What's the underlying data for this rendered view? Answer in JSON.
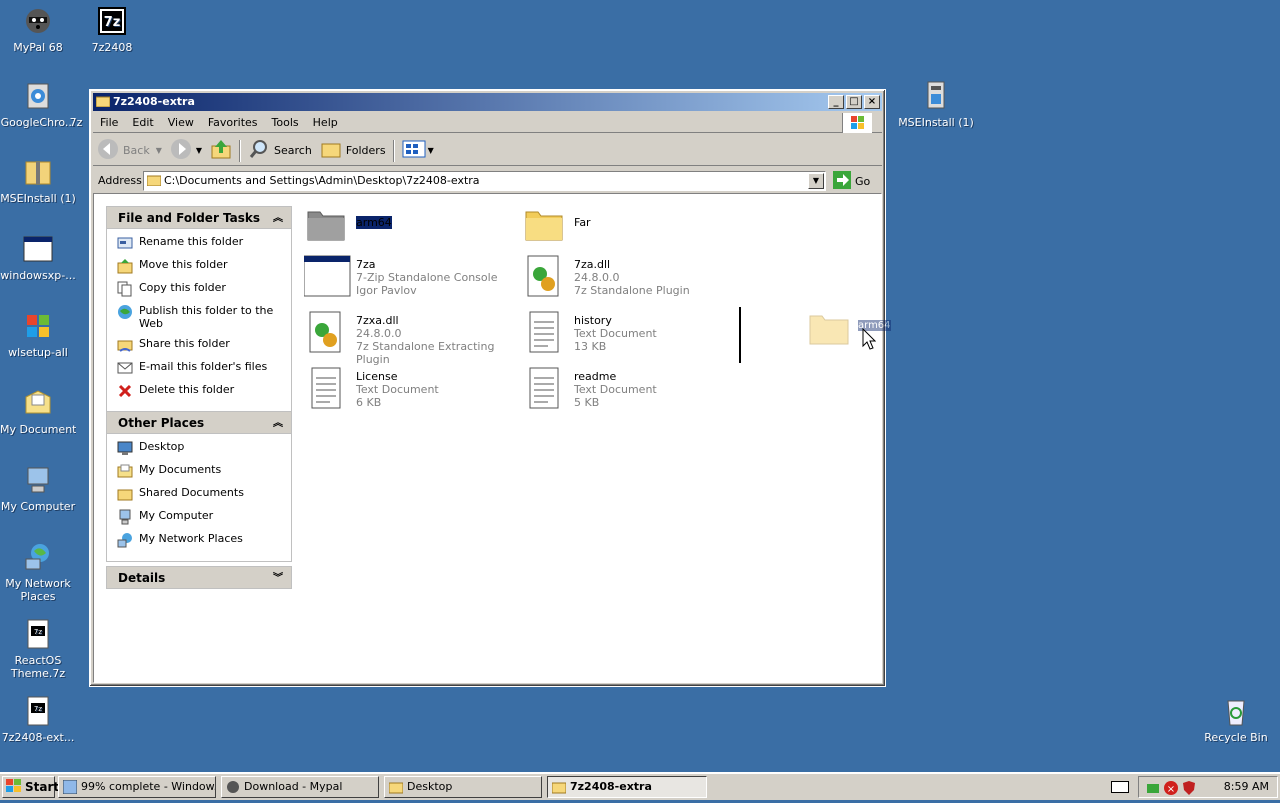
{
  "desktop": {
    "icons": [
      {
        "label": "MyPal 68"
      },
      {
        "label": "7z2408"
      },
      {
        "label": "GoogleChro..."
      },
      {
        "label": "7z"
      },
      {
        "label": "MSEInstall (1)"
      },
      {
        "label": "windowsxp-..."
      },
      {
        "label": "wlsetup-all"
      },
      {
        "label": "My Documents"
      },
      {
        "label": "My Computer"
      },
      {
        "label": "My Network Places"
      },
      {
        "label": "ReactOS Theme.7z"
      },
      {
        "label": "7z2408-ext..."
      },
      {
        "label": "MSEInstall (1)"
      },
      {
        "label": "Recycle Bin"
      }
    ]
  },
  "window": {
    "title": "7z2408-extra",
    "menu": [
      "File",
      "Edit",
      "View",
      "Favorites",
      "Tools",
      "Help"
    ],
    "toolbar": {
      "back": "Back",
      "search": "Search",
      "folders": "Folders"
    },
    "address": {
      "label": "Address",
      "value": "C:\\Documents and Settings\\Admin\\Desktop\\7z2408-extra",
      "go": "Go"
    },
    "tasks_panel": {
      "title": "File and Folder Tasks",
      "items": [
        "Rename this folder",
        "Move this folder",
        "Copy this folder",
        "Publish this folder to the Web",
        "Share this folder",
        "E-mail this folder's files",
        "Delete this folder"
      ]
    },
    "places_panel": {
      "title": "Other Places",
      "items": [
        "Desktop",
        "My Documents",
        "Shared Documents",
        "My Computer",
        "My Network Places"
      ]
    },
    "details_panel": {
      "title": "Details"
    },
    "files": [
      {
        "name": "arm64",
        "line2": "",
        "line3": ""
      },
      {
        "name": "Far",
        "line2": "",
        "line3": ""
      },
      {
        "name": "7za",
        "line2": "7-Zip Standalone Console",
        "line3": "Igor Pavlov"
      },
      {
        "name": "7za.dll",
        "line2": "24.8.0.0",
        "line3": "7z Standalone Plugin"
      },
      {
        "name": "7zxa.dll",
        "line2": "24.8.0.0",
        "line3": "7z Standalone Extracting Plugin"
      },
      {
        "name": "history",
        "line2": "Text Document",
        "line3": "13 KB"
      },
      {
        "name": "License",
        "line2": "Text Document",
        "line3": "6 KB"
      },
      {
        "name": "readme",
        "line2": "Text Document",
        "line3": "5 KB"
      }
    ],
    "drag_ghost_label": "arm64"
  },
  "taskbar": {
    "start": "Start",
    "buttons": [
      "99% complete - Window...",
      "Download - Mypal",
      "Desktop",
      "7z2408-extra"
    ],
    "clock": "8:59 AM"
  }
}
